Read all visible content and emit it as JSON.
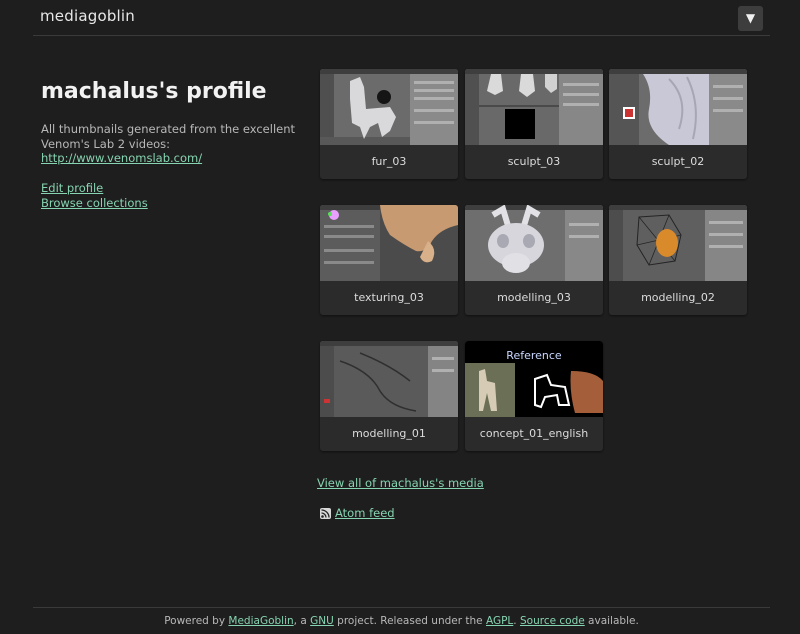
{
  "header": {
    "logo": "mediagoblin",
    "menu_icon": "▼"
  },
  "profile": {
    "title": "machalus's profile",
    "bio_line1": "All thumbnails generated from the excellent",
    "bio_line2": "Venom's Lab 2 videos:",
    "bio_link": "http://www.venomslab.com/",
    "edit_profile": "Edit profile",
    "browse_collections": "Browse collections"
  },
  "media": [
    {
      "title": "fur_03",
      "thumb_icon": "blender-screenshot-llama-fur"
    },
    {
      "title": "sculpt_03",
      "thumb_icon": "blender-screenshot-sculpt-feet"
    },
    {
      "title": "sculpt_02",
      "thumb_icon": "blender-screenshot-sculpt-body"
    },
    {
      "title": "texturing_03",
      "thumb_icon": "blender-screenshot-texturing"
    },
    {
      "title": "modelling_03",
      "thumb_icon": "blender-screenshot-head-model"
    },
    {
      "title": "modelling_02",
      "thumb_icon": "blender-screenshot-wireframe"
    },
    {
      "title": "modelling_01",
      "thumb_icon": "blender-screenshot-mesh"
    },
    {
      "title": "concept_01_english",
      "thumb_icon": "reference-concept-image",
      "thumb_caption": "Reference"
    }
  ],
  "links": {
    "view_all": "View all of machalus's media",
    "atom_feed": "Atom feed",
    "feed_icon": "rss-feed-icon"
  },
  "footer": {
    "powered_by": "Powered by ",
    "mediagoblin": "MediaGoblin",
    "comma_a": ", a ",
    "gnu": "GNU",
    "project": " project. Released under the ",
    "agpl": "AGPL",
    "period": ". ",
    "source_code": "Source code",
    "available": " available."
  },
  "colors": {
    "background": "#1e1e1e",
    "link": "#86d4b1",
    "tile": "#2b2b2b"
  }
}
